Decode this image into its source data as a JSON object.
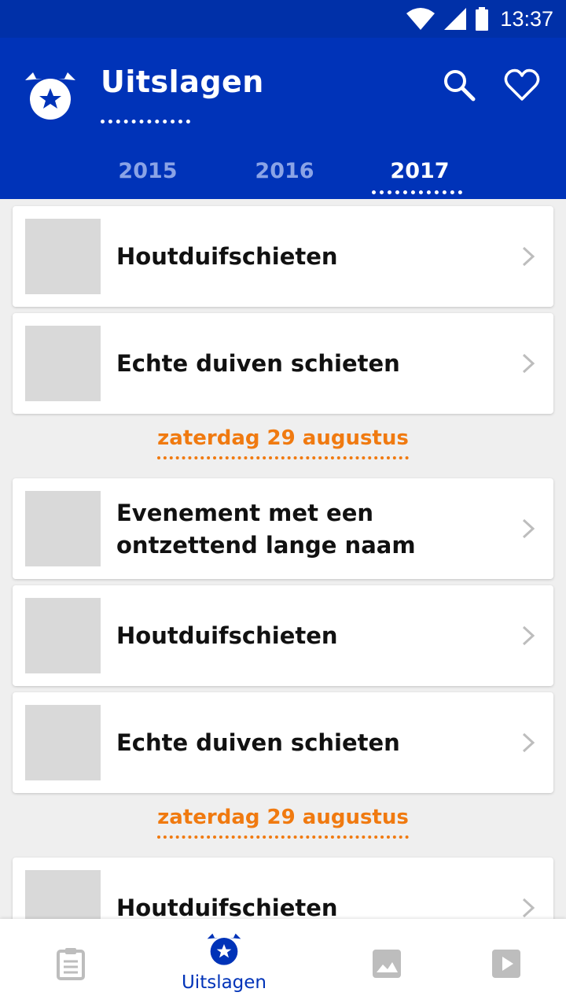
{
  "status_bar": {
    "time": "13:37"
  },
  "app_bar": {
    "title": "Uitslagen"
  },
  "tabs": [
    {
      "label": "2015",
      "active": false
    },
    {
      "label": "2016",
      "active": false
    },
    {
      "label": "2017",
      "active": true
    }
  ],
  "list": {
    "items_top": [
      {
        "title": "Houtduifschieten"
      },
      {
        "title": "Echte duiven schieten"
      }
    ],
    "section_1": {
      "date": "zaterdag 29 augustus",
      "items": [
        {
          "title": "Evenement met een ontzettend lange naam"
        },
        {
          "title": "Houtduifschieten"
        },
        {
          "title": "Echte duiven schieten"
        }
      ]
    },
    "section_2": {
      "date": "zaterdag 29 augustus",
      "items": [
        {
          "title": "Houtduifschieten"
        }
      ]
    }
  },
  "bottom_nav": {
    "items": [
      {
        "icon": "clipboard-icon",
        "label": "",
        "active": false
      },
      {
        "icon": "medal-star-icon",
        "label": "Uitslagen",
        "active": true
      },
      {
        "icon": "image-icon",
        "label": "",
        "active": false
      },
      {
        "icon": "play-icon",
        "label": "",
        "active": false
      }
    ]
  },
  "colors": {
    "primary": "#0033b8",
    "accent": "#f07a10",
    "placeholder": "#d9d9d9"
  }
}
